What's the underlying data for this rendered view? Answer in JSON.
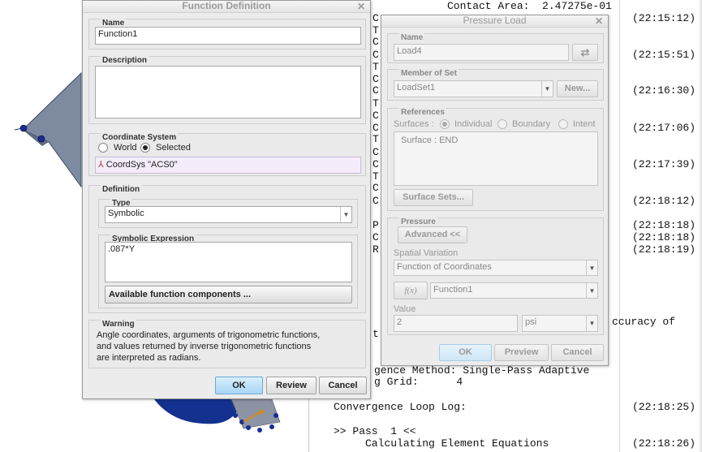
{
  "log": {
    "lines": [
      {
        "t": "Contact Area:  2.47275e-01",
        "time": ""
      },
      {
        "t": "C",
        "time": "(22:15:12)"
      },
      {
        "t": "T",
        "time": ""
      },
      {
        "t": "C",
        "time": ""
      },
      {
        "t": "C",
        "time": "(22:15:51)"
      },
      {
        "t": "T",
        "time": ""
      },
      {
        "t": "C",
        "time": ""
      },
      {
        "t": "C",
        "time": "(22:16:30)"
      },
      {
        "t": "T",
        "time": ""
      },
      {
        "t": "C",
        "time": ""
      },
      {
        "t": "C",
        "time": "(22:17:06)"
      },
      {
        "t": "T",
        "time": ""
      },
      {
        "t": "C",
        "time": ""
      },
      {
        "t": "C",
        "time": "(22:17:39)"
      },
      {
        "t": "T",
        "time": ""
      },
      {
        "t": "C",
        "time": ""
      },
      {
        "t": "C",
        "time": "(22:18:12)"
      },
      {
        "t": "",
        "time": ""
      },
      {
        "t": "P",
        "time": "(22:18:18)"
      },
      {
        "t": "C",
        "time": "(22:18:18)"
      },
      {
        "t": "R",
        "time": "(22:18:19)"
      }
    ],
    "right_fragment_1": "ccuracy of",
    "right_fragment_2": "t",
    "convergence_method": "gence Method: Single-Pass Adaptive",
    "grid": "g Grid:      4",
    "loop_log": "Convergence Loop Log:",
    "loop_log_time": "(22:18:25)",
    "pass": ">> Pass  1 <<",
    "calc": "     Calculating Element Equations",
    "calc_time": "(22:18:26)"
  },
  "function_definition": {
    "title": "Function Definition",
    "name_label": "Name",
    "name_value": "Function1",
    "description_label": "Description",
    "description_value": "",
    "coord_label": "Coordinate System",
    "world_label": "World",
    "selected_label": "Selected",
    "coord_value": "CoordSys \"ACS0\"",
    "definition_label": "Definition",
    "type_label": "Type",
    "type_value": "Symbolic",
    "expr_label": "Symbolic Expression",
    "expr_value": ".087*Y",
    "components_button": "Available function components ...",
    "warning_label": "Warning",
    "warning_line1": "Angle coordinates, arguments of trigonometric functions,",
    "warning_line2": "and values returned by inverse trigonometric functions",
    "warning_line3": "are interpreted as radians.",
    "ok": "OK",
    "review": "Review",
    "cancel": "Cancel"
  },
  "pressure_load": {
    "title": "Pressure Load",
    "name_label": "Name",
    "name_value": "Load4",
    "member_label": "Member of Set",
    "member_value": "LoadSet1",
    "new_button": "New...",
    "references_label": "References",
    "surfaces_label": "Surfaces :",
    "individual_label": "Individual",
    "boundary_label": "Boundary",
    "intent_label": "Intent",
    "surface_entry": "Surface : END",
    "surface_sets_button": "Surface Sets...",
    "pressure_label": "Pressure",
    "advanced_button": "Advanced <<",
    "spatial_label": "Spatial Variation",
    "spatial_value": "Function of Coordinates",
    "fx_button": "f(x)",
    "function_value": "Function1",
    "value_label": "Value",
    "value": "2",
    "units": "psi",
    "ok": "OK",
    "preview": "Preview",
    "cancel": "Cancel"
  },
  "colors": {
    "model_fill": "#6f7f95",
    "model_dark": "#12308a",
    "ok_button": "#a7d6f6"
  }
}
